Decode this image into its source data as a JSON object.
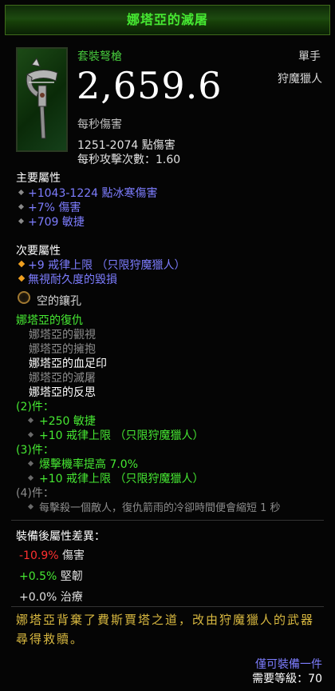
{
  "item": {
    "name": "娜塔亞的滅屠",
    "type": "套裝弩槍",
    "slot": "單手",
    "class_restriction": "狩魔獵人",
    "dps": "2,659.6",
    "dps_label": "每秒傷害",
    "damage_range": "1251-2074 點傷害",
    "attacks_per_second": "每秒攻擊次數：1.60",
    "icon": "hand-crossbow-icon"
  },
  "primary": {
    "title": "主要屬性",
    "stats": [
      "+1043-1224 點冰寒傷害",
      "+7% 傷害",
      "+709 敏捷"
    ]
  },
  "secondary": {
    "title": "次要屬性",
    "stats": [
      "+9 戒律上限 （只限狩魔獵人）",
      "無視耐久度的毀損"
    ]
  },
  "socket": {
    "label": "空的鑲孔"
  },
  "set": {
    "name": "娜塔亞的復仇",
    "pieces": [
      "娜塔亞的觀視",
      "娜塔亞的擁抱",
      "娜塔亞的血足印",
      "娜塔亞的滅屠",
      "娜塔亞的反思"
    ],
    "bonuses": [
      {
        "label": "(2)件：",
        "stats": [
          "+250 敏捷",
          "+10 戒律上限 （只限狩魔獵人）"
        ]
      },
      {
        "label": "(3)件：",
        "stats": [
          "爆擊機率提高 7.0%",
          "+10 戒律上限 （只限狩魔獵人）"
        ]
      },
      {
        "label": "(4)件：",
        "stats": [
          "每擊殺一個敵人，復仇箭雨的冷卻時間便會縮短 1 秒"
        ]
      }
    ]
  },
  "compare": {
    "title": "裝備後屬性差異：",
    "rows": [
      {
        "value": "-10.9%",
        "label": "傷害"
      },
      {
        "value": "+0.5%",
        "label": "堅韌"
      },
      {
        "value": "+0.0%",
        "label": "治療"
      }
    ]
  },
  "flavor": "娜塔亞背棄了費斯賈塔之道，改由狩魔獵人的武器尋得救贖。",
  "footer": {
    "equip": "僅可裝備一件",
    "level": "需要等級：70"
  },
  "colors": {
    "set_green": "#46e832",
    "magic_blue": "#7d7dff",
    "negative_red": "#ff3030",
    "flavor_gold": "#d8b840"
  }
}
